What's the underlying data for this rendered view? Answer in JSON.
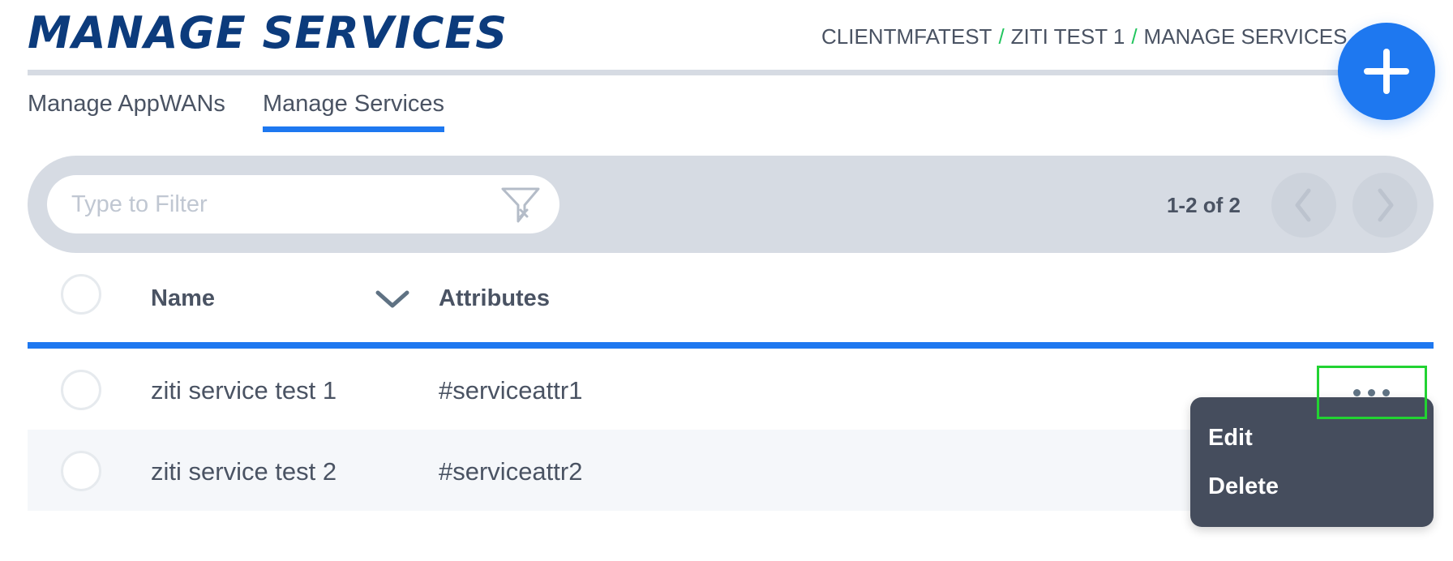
{
  "header": {
    "title": "MANAGE SERVICES",
    "breadcrumb": [
      "CLIENTMFATEST",
      "ZITI TEST 1",
      "MANAGE SERVICES"
    ],
    "breadcrumb_separator": "/"
  },
  "fab": {
    "icon": "plus-icon"
  },
  "tabs": [
    {
      "label": "Manage AppWANs",
      "active": false
    },
    {
      "label": "Manage Services",
      "active": true
    }
  ],
  "filter": {
    "placeholder": "Type to Filter",
    "value": "",
    "icon": "funnel-icon"
  },
  "pagination": {
    "text": "1-2 of 2",
    "prev_icon": "chevron-left-icon",
    "next_icon": "chevron-right-icon"
  },
  "table": {
    "columns": [
      "Name",
      "Attributes"
    ],
    "sort_icon": "chevron-down-icon",
    "rows": [
      {
        "name": "ziti service test 1",
        "attributes": "#serviceattr1"
      },
      {
        "name": "ziti service test 2",
        "attributes": "#serviceattr2"
      }
    ]
  },
  "row_menu": {
    "items": [
      "Edit",
      "Delete"
    ]
  },
  "colors": {
    "accent": "#1e78f0",
    "title": "#0c3b7c",
    "breadcrumb_separator": "#22c55e",
    "menu_bg": "#454d5d",
    "highlight": "#22d332"
  }
}
